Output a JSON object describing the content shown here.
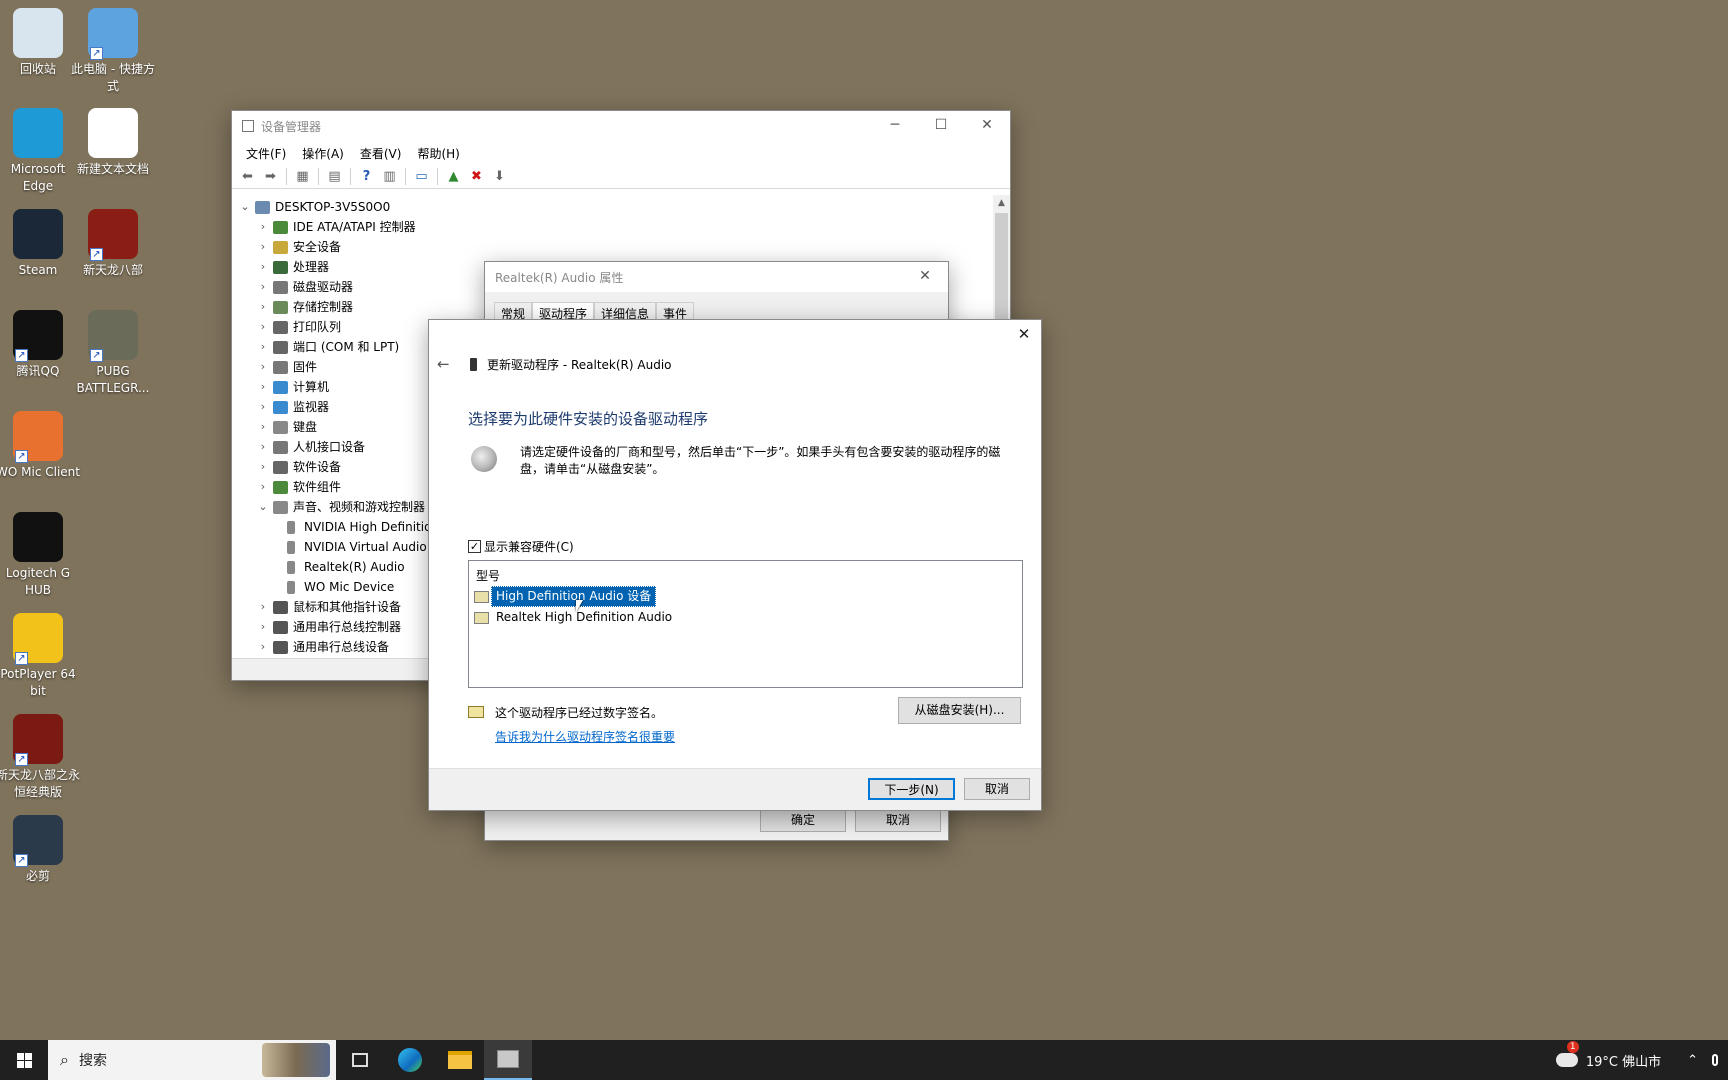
{
  "desktop": {
    "icons": [
      {
        "label": "回收站",
        "color": "#d8e4ee",
        "shortcut": false
      },
      {
        "label": "此电脑 - 快捷方式",
        "color": "#5da3e0",
        "shortcut": true
      },
      {
        "label": "Microsoft Edge",
        "color": "#1e9bd7",
        "shortcut": false
      },
      {
        "label": "新建文本文档",
        "color": "#ffffff",
        "shortcut": false
      },
      {
        "label": "Steam",
        "color": "#1b2838",
        "shortcut": false
      },
      {
        "label": "新天龙八部",
        "color": "#8a1e14",
        "shortcut": true
      },
      {
        "label": "腾讯QQ",
        "color": "#111111",
        "shortcut": true
      },
      {
        "label": "PUBG BATTLEGR...",
        "color": "#6b6b5a",
        "shortcut": true
      },
      {
        "label": "WO Mic Client",
        "color": "#e8712f",
        "shortcut": true
      },
      {
        "label": "Logitech G HUB",
        "color": "#111111",
        "shortcut": false
      },
      {
        "label": "PotPlayer 64 bit",
        "color": "#f2c21b",
        "shortcut": true
      },
      {
        "label": "新天龙八部之永恒经典版",
        "color": "#7a1a12",
        "shortcut": true
      },
      {
        "label": "必剪",
        "color": "#2b3a4a",
        "shortcut": true
      }
    ]
  },
  "device_manager": {
    "title": "设备管理器",
    "menu": [
      "文件(F)",
      "操作(A)",
      "查看(V)",
      "帮助(H)"
    ],
    "root": "DESKTOP-3V5S0O0",
    "categories": [
      {
        "label": "IDE ATA/ATAPI 控制器",
        "expanded": false,
        "color": "#4a8a3a"
      },
      {
        "label": "安全设备",
        "expanded": false,
        "color": "#c8a83a"
      },
      {
        "label": "处理器",
        "expanded": false,
        "color": "#3a6a3a"
      },
      {
        "label": "磁盘驱动器",
        "expanded": false,
        "color": "#777777"
      },
      {
        "label": "存储控制器",
        "expanded": false,
        "color": "#6a8a5a"
      },
      {
        "label": "打印队列",
        "expanded": false,
        "color": "#666666"
      },
      {
        "label": "端口 (COM 和 LPT)",
        "expanded": false,
        "color": "#666666"
      },
      {
        "label": "固件",
        "expanded": false,
        "color": "#777777"
      },
      {
        "label": "计算机",
        "expanded": false,
        "color": "#3a8ad0"
      },
      {
        "label": "监视器",
        "expanded": false,
        "color": "#3a8ad0"
      },
      {
        "label": "键盘",
        "expanded": false,
        "color": "#888888"
      },
      {
        "label": "人机接口设备",
        "expanded": false,
        "color": "#777777"
      },
      {
        "label": "软件设备",
        "expanded": false,
        "color": "#666666"
      },
      {
        "label": "软件组件",
        "expanded": false,
        "color": "#4a8a3a"
      },
      {
        "label": "声音、视频和游戏控制器",
        "expanded": true,
        "color": "#888888"
      },
      {
        "label": "NVIDIA High Definition Audio",
        "child": true,
        "color": "#888888"
      },
      {
        "label": "NVIDIA Virtual Audio Device",
        "child": true,
        "color": "#888888"
      },
      {
        "label": "Realtek(R) Audio",
        "child": true,
        "color": "#888888"
      },
      {
        "label": "WO Mic Device",
        "child": true,
        "color": "#888888"
      },
      {
        "label": "鼠标和其他指针设备",
        "expanded": false,
        "color": "#555555"
      },
      {
        "label": "通用串行总线控制器",
        "expanded": false,
        "color": "#555555"
      },
      {
        "label": "通用串行总线设备",
        "expanded": false,
        "color": "#555555"
      }
    ]
  },
  "properties": {
    "title": "Realtek(R) Audio 属性",
    "tabs": [
      "常规",
      "驱动程序",
      "详细信息",
      "事件"
    ],
    "active_tab": "驱动程序",
    "ok_label": "确定",
    "cancel_label": "取消"
  },
  "wizard": {
    "title": "更新驱动程序 - Realtek(R) Audio",
    "heading": "选择要为此硬件安装的设备驱动程序",
    "description": "请选定硬件设备的厂商和型号，然后单击“下一步”。如果手头有包含要安装的驱动程序的磁盘，请单击“从磁盘安装”。",
    "show_compatible_label": "显示兼容硬件(C)",
    "show_compatible_checked": true,
    "list_header": "型号",
    "models": [
      {
        "label": "High Definition Audio 设备",
        "selected": true
      },
      {
        "label": "Realtek High Definition Audio",
        "selected": false
      }
    ],
    "signed_text": "这个驱动程序已经过数字签名。",
    "signing_link": "告诉我为什么驱动程序签名很重要",
    "have_disk_label": "从磁盘安装(H)...",
    "next_label": "下一步(N)",
    "cancel_label": "取消"
  },
  "taskbar": {
    "search_placeholder": "搜索",
    "weather": "19°C 佛山市",
    "weather_badge": "1"
  }
}
